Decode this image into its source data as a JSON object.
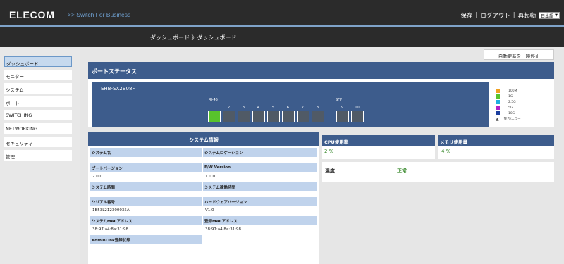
{
  "header": {
    "logo": "ELECOM",
    "subtitle": ">>  Switch For Business",
    "save": "保存",
    "logout": "ログアウト",
    "reboot": "再起動",
    "separator": "|",
    "language": "日本語"
  },
  "breadcrumb": "ダッシュボード 》ダッシュボード",
  "sidebar": {
    "items": [
      {
        "label": "ダッシュボード"
      },
      {
        "label": "モニター"
      },
      {
        "label": "システム"
      },
      {
        "label": "ポート"
      },
      {
        "label": "SWITCHING"
      },
      {
        "label": "NETWORKING"
      },
      {
        "label": "セキュリティ"
      },
      {
        "label": "管理"
      }
    ]
  },
  "auto_update_button": "自動更新を一時停止",
  "port_status": {
    "title": "ポートステータス",
    "device": "EHB-SX2B08F",
    "rj45_label": "RJ-45",
    "sfp_label": "SFP",
    "ports": [
      {
        "number": "1",
        "state": "1G"
      },
      {
        "number": "2",
        "state": "down"
      },
      {
        "number": "3",
        "state": "down"
      },
      {
        "number": "4",
        "state": "down"
      },
      {
        "number": "5",
        "state": "down"
      },
      {
        "number": "6",
        "state": "down"
      },
      {
        "number": "7",
        "state": "down"
      },
      {
        "number": "8",
        "state": "down"
      },
      {
        "number": "9",
        "state": "down"
      },
      {
        "number": "10",
        "state": "down"
      }
    ],
    "legend": [
      {
        "label": "100M",
        "color": "#f0a020"
      },
      {
        "label": "1G",
        "color": "#58c32c"
      },
      {
        "label": "2.5G",
        "color": "#1eaee0"
      },
      {
        "label": "5G",
        "color": "#b020c8"
      },
      {
        "label": "10G",
        "color": "#1c3f9f"
      },
      {
        "label": "警告/エラー",
        "icon": "warning-icon"
      }
    ]
  },
  "system_info": {
    "title": "システム情報",
    "fields": {
      "system_name": {
        "label": "システム名",
        "value": ""
      },
      "system_location": {
        "label": "システムロケーション",
        "value": ""
      },
      "boot_version": {
        "label": "ブートバージョン",
        "value": "2.0.0"
      },
      "fw_version": {
        "label": "F/W Version",
        "value": "1.0.0"
      },
      "system_time": {
        "label": "システム時間",
        "value": ""
      },
      "uptime": {
        "label": "システム稼働時間",
        "value": ""
      },
      "serial": {
        "label": "シリアル番号",
        "value": "1B53L212300035A"
      },
      "hw_version": {
        "label": "ハードウェアバージョン",
        "value": "V1.0"
      },
      "sys_mac": {
        "label": "システムMACアドレス",
        "value": "38:97:a4:8a:31:98"
      },
      "reg_mac": {
        "label": "登録MACアドレス",
        "value": "38:97:a4:8a:31:98"
      },
      "adminlink": {
        "label": "AdminLink登録状態",
        "value": ""
      }
    }
  },
  "cpu": {
    "title": "CPU使用率",
    "value": "2 %"
  },
  "memory": {
    "title": "メモリ使用量",
    "value": "4 %"
  },
  "health": {
    "label": "温度",
    "value": "正常"
  }
}
